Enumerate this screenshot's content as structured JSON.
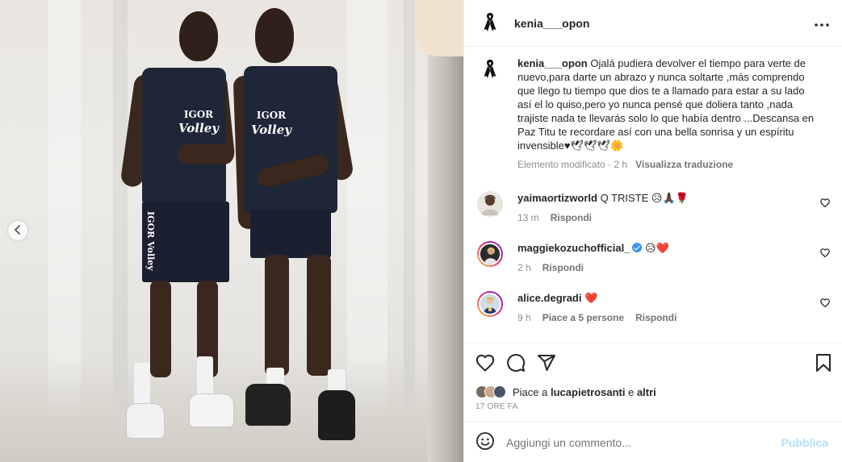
{
  "post": {
    "username": "kenia___opon",
    "avatar_icon": "black-ribbon-icon",
    "media": {
      "shirt_brand": "IGOR",
      "shirt_team": "Volley",
      "shorts_label": "IGOR Volley",
      "prev_icon": "chevron-left-icon"
    },
    "caption": {
      "username": "kenia___opon",
      "text": "Ojalá pudiera devolver el tiempo para verte de nuevo,para darte un abrazo y nunca soltarte ,más comprendo que llego tu tiempo que dios te a llamado para estar a su lado así el lo quiso,pero yo nunca pensé que doliera tanto ,nada trajiste nada te llevarás solo lo que había dentro ...Descansa en Paz Titu te recordare así con una bella sonrisa y un espíritu invensible♥🕊🕊🕊🌼",
      "edited": "Elemento modificato · 2 h",
      "translate": "Visualizza traduzione"
    },
    "comments": [
      {
        "username": "yaimaortizworld",
        "verified": false,
        "text": "Q TRISTE 😥🙏🏿🌹",
        "time": "13 m",
        "likes": "",
        "reply": "Rispondi"
      },
      {
        "username": "maggiekozuchofficial_",
        "verified": true,
        "text": "😥❤️",
        "time": "2 h",
        "likes": "",
        "reply": "Rispondi"
      },
      {
        "username": "alice.degradi",
        "verified": false,
        "text": "❤️",
        "time": "9 h",
        "likes": "Piace a 5 persone",
        "reply": "Rispondi"
      }
    ],
    "actions": {
      "like_icon": "heart-outline-icon",
      "comment_icon": "comment-bubble-icon",
      "share_icon": "paper-plane-icon",
      "save_icon": "bookmark-icon"
    },
    "likes": {
      "prefix": "Piace a",
      "name": "lucapietrosanti",
      "joiner": "e",
      "others": "altri"
    },
    "timestamp": "17 ORE FA",
    "add_comment": {
      "placeholder": "Aggiungi un commento...",
      "publish": "Pubblica",
      "emoji_icon": "smiley-icon"
    },
    "colors": {
      "accent": "#0095f6",
      "publish_disabled": "#b2dffc",
      "heart_red": "#ed4956",
      "jersey_navy": "#1e2637"
    }
  }
}
